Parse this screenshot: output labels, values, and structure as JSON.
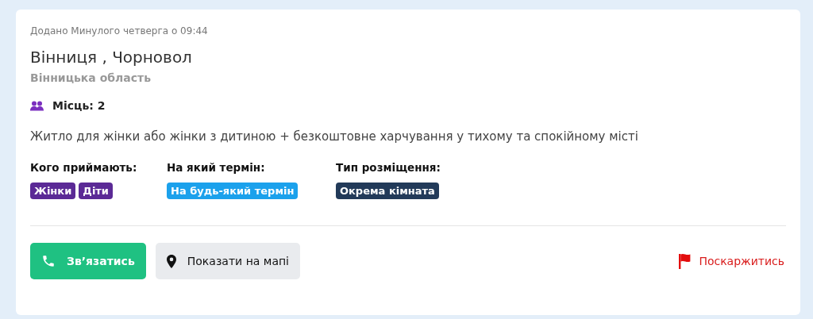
{
  "listing": {
    "added": "Додано Минулого четверга о 09:44",
    "title": "Вінниця , Чорновол",
    "region": "Вінницька область",
    "seats": "Місць: 2",
    "description": "Житло для жінки або жінки з дитиною + безкоштовне харчування у тихому та спокійному місті",
    "criteria": [
      {
        "label": "Кого приймають:",
        "tags": [
          {
            "text": "Жінки",
            "color": "#5b2a96"
          },
          {
            "text": "Діти",
            "color": "#5b2a96"
          }
        ]
      },
      {
        "label": "На який термін:",
        "tags": [
          {
            "text": "На будь-який термін",
            "color": "#1ba1ec"
          }
        ]
      },
      {
        "label": "Тип розміщення:",
        "tags": [
          {
            "text": "Окрема кімната",
            "color": "#223a59"
          }
        ]
      }
    ],
    "buttons": {
      "contact": "Зв’язатись",
      "map": "Показати на мапі",
      "report": "Поскаржитись"
    }
  }
}
